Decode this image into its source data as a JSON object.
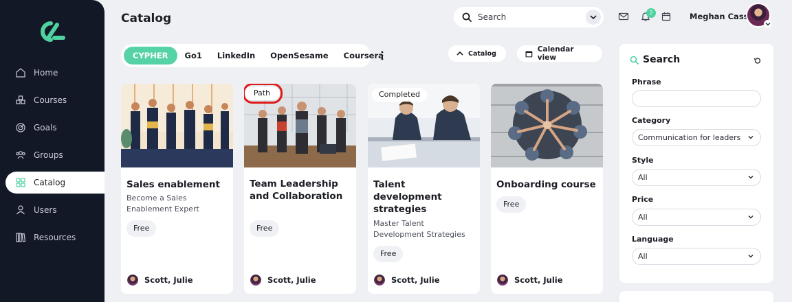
{
  "sidebar": {
    "logo": "logo-icon",
    "items": [
      {
        "label": "Home",
        "icon": "home-icon"
      },
      {
        "label": "Courses",
        "icon": "courses-icon"
      },
      {
        "label": "Goals",
        "icon": "goals-icon"
      },
      {
        "label": "Groups",
        "icon": "groups-icon"
      },
      {
        "label": "Catalog",
        "icon": "catalog-icon",
        "active": true
      },
      {
        "label": "Users",
        "icon": "user-icon"
      },
      {
        "label": "Resources",
        "icon": "resources-icon"
      }
    ]
  },
  "header": {
    "title": "Catalog",
    "search_label": "Search",
    "notifications_count": "2",
    "user_name": "Meghan Cass"
  },
  "providers": {
    "tabs": [
      "CYPHER",
      "Go1",
      "LinkedIn",
      "OpenSesame",
      "Coursera"
    ],
    "active": "CYPHER"
  },
  "actions": {
    "catalog_label": "Catalog",
    "calendar_label": "Calendar view"
  },
  "cards": [
    {
      "title": "Sales enablement",
      "subtitle": "Become a Sales Enablement Expert",
      "price": "Free",
      "author": "Scott, Julie",
      "badge": ""
    },
    {
      "title": "Team Leadership and Collaboration",
      "subtitle": "",
      "price": "Free",
      "author": "Scott, Julie",
      "badge": "Path"
    },
    {
      "title": "Talent development strategies",
      "subtitle": "Master Talent Development Strategies",
      "price": "Free",
      "author": "Scott, Julie",
      "badge": "Completed"
    },
    {
      "title": "Onboarding course",
      "subtitle": "",
      "price": "Free",
      "author": "Scott, Julie",
      "badge": ""
    }
  ],
  "filter_panel": {
    "title": "Search",
    "phrase_label": "Phrase",
    "phrase_value": "",
    "category_label": "Category",
    "category_value": "Communication for leaders",
    "style_label": "Style",
    "style_value": "All",
    "price_label": "Price",
    "price_value": "All",
    "language_label": "Language",
    "language_value": "All"
  },
  "colors": {
    "sidebar_bg": "#121826",
    "accent": "#56d3a6",
    "highlight": "#e01a1a"
  }
}
